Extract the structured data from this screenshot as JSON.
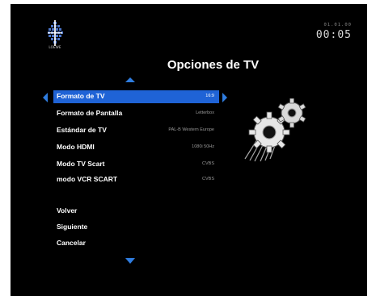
{
  "header": {
    "logo_text": "LOEWE",
    "date": "01.01.00",
    "time": "00:05",
    "title": "Opciones de TV"
  },
  "menu": {
    "items": [
      {
        "label": "Formato de TV",
        "value": "16:9",
        "selected": true
      },
      {
        "label": "Formato de Pantalla",
        "value": "Letterbox"
      },
      {
        "label": "Estándar de TV",
        "value": "PAL-B Western Europe"
      },
      {
        "label": "Modo HDMI",
        "value": "1080i 50Hz"
      },
      {
        "label": "Modo TV Scart",
        "value": "CVBS"
      },
      {
        "label": "modo VCR SCART",
        "value": "CVBS"
      }
    ],
    "actions": [
      "Volver",
      "Siguiente",
      "Cancelar"
    ]
  },
  "icons": {
    "logo": "brand-logo-icon",
    "gears": "gears-icon",
    "up": "arrow-up-icon",
    "down": "arrow-down-icon",
    "left": "arrow-left-icon",
    "right": "arrow-right-icon"
  },
  "colors": {
    "background": "#000000",
    "highlight": "#1f63d6",
    "arrow": "#2f7de0",
    "text": "#ffffff",
    "value_text": "#9a9a9a"
  }
}
